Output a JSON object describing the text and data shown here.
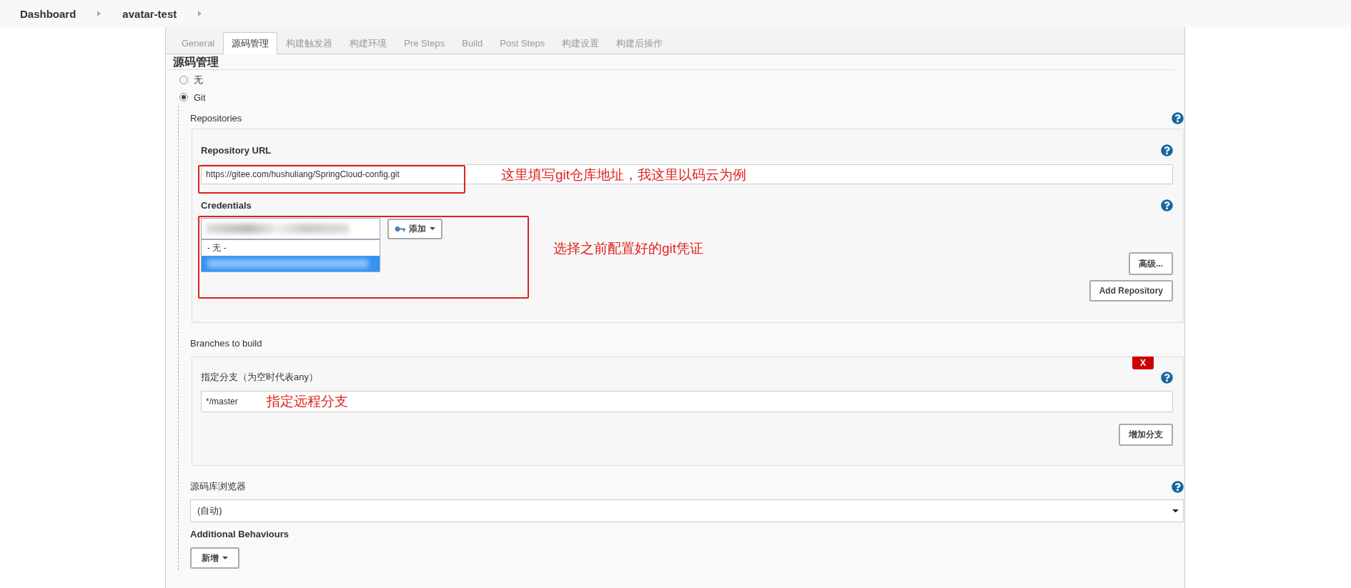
{
  "breadcrumbs": [
    {
      "label": "Dashboard"
    },
    {
      "label": "avatar-test"
    }
  ],
  "tabs": [
    {
      "label": "General",
      "selected": false
    },
    {
      "label": "源码管理",
      "selected": true
    },
    {
      "label": "构建触发器",
      "selected": false
    },
    {
      "label": "构建环境",
      "selected": false
    },
    {
      "label": "Pre Steps",
      "selected": false
    },
    {
      "label": "Build",
      "selected": false
    },
    {
      "label": "Post Steps",
      "selected": false
    },
    {
      "label": "构建设置",
      "selected": false
    },
    {
      "label": "构建后操作",
      "selected": false
    }
  ],
  "section_title": "源码管理",
  "scm_options": [
    {
      "label": "无",
      "selected": false
    },
    {
      "label": "Git",
      "selected": true
    }
  ],
  "repositories": {
    "label": "Repositories",
    "url_label": "Repository URL",
    "url_value": "https://gitee.com/hushuliang/SpringCloud-config.git",
    "url_note": "这里填写git仓库地址，我这里以码云为例",
    "credentials_label": "Credentials",
    "credentials_open": true,
    "credentials_options": [
      {
        "label": "- 无 -",
        "selected": false
      },
      {
        "selected": true
      }
    ],
    "credentials_note": "选择之前配置好的git凭证",
    "add_button": "添加",
    "advanced_button": "高级...",
    "add_repository_button": "Add Repository"
  },
  "branches": {
    "label": "Branches to build",
    "delete_button": "X",
    "branch_label": "指定分支（为空时代表any）",
    "branch_value": "*/master",
    "branch_note": "指定远程分支",
    "add_branch_button": "增加分支"
  },
  "browser": {
    "label": "源码库浏览器",
    "value": "(自动)"
  },
  "additional": {
    "label": "Additional Behaviours",
    "button": "新增"
  }
}
